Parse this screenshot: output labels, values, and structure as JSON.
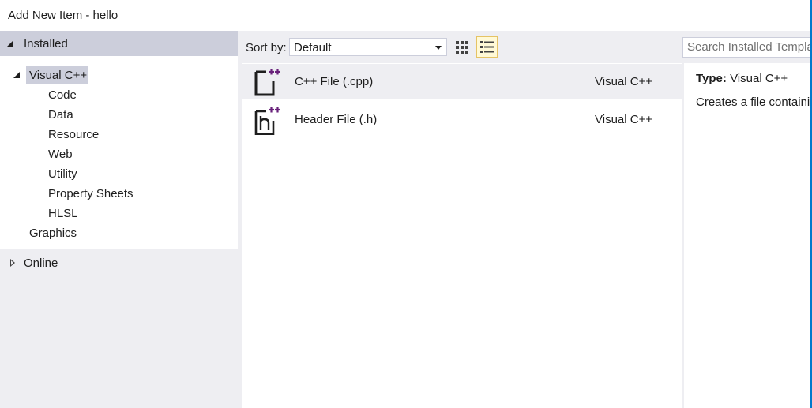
{
  "window": {
    "title": "Add New Item - hello"
  },
  "left_pane": {
    "installed_label": "Installed",
    "tree": [
      {
        "label": "Visual C++",
        "level": 0,
        "selected": true,
        "expanded": true
      },
      {
        "label": "Code",
        "level": 1
      },
      {
        "label": "Data",
        "level": 1
      },
      {
        "label": "Resource",
        "level": 1
      },
      {
        "label": "Web",
        "level": 1
      },
      {
        "label": "Utility",
        "level": 1
      },
      {
        "label": "Property Sheets",
        "level": 1
      },
      {
        "label": "HLSL",
        "level": 1
      },
      {
        "label": "Graphics",
        "level": 0
      }
    ],
    "online_label": "Online"
  },
  "toolbar": {
    "sort_label": "Sort by:",
    "sort_value": "Default",
    "active_view": "list",
    "search_placeholder": "Search Installed Templates"
  },
  "templates": [
    {
      "name": "C++ File (.cpp)",
      "language": "Visual C++",
      "icon": "cpp-file-icon",
      "selected": true
    },
    {
      "name": "Header File (.h)",
      "language": "Visual C++",
      "icon": "header-file-icon",
      "selected": false
    }
  ],
  "detail": {
    "type_label": "Type:",
    "type_value": "Visual C++",
    "description": "Creates a file containing C++ source code"
  },
  "colors": {
    "accent": "#007acc",
    "pane_bg": "#eeeef2",
    "selection": "#cccedb",
    "plus_icon": "#68217a"
  }
}
